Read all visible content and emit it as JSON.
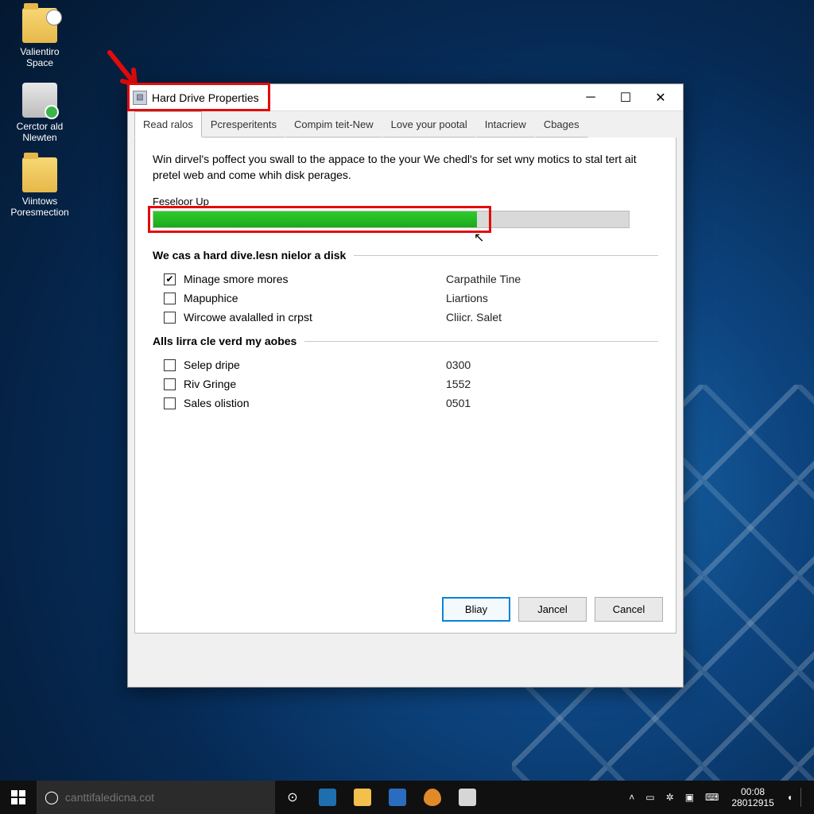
{
  "desktop_icons": [
    {
      "label": "Valientiro Space"
    },
    {
      "label": "Cerctor ald Nlewten"
    },
    {
      "label": "Viintows Poresmection"
    }
  ],
  "window": {
    "title": "Hard Drive Properties",
    "tabs": [
      "Read ralos",
      "Pcresperitents",
      "Compim teit-New",
      "Love your pootal",
      "Intacriew",
      "Cbages"
    ],
    "description": "Win dirvel's poffect you swall to the appace to the your We chedl's for set wny motics to stal tert ait pretel web and come whih disk perages.",
    "progress_label": "Feseloor Up",
    "section1": {
      "title": "We cas a hard dive.lesn nielor a disk",
      "rows": [
        {
          "checked": true,
          "label": "Minage smore mores",
          "value": "Carpathile  Tine"
        },
        {
          "checked": false,
          "label": "Mapuphice",
          "value": "Liartions"
        },
        {
          "checked": false,
          "label": "Wircowe avalalled in crpst",
          "value": "Cliicr. Salet"
        }
      ]
    },
    "section2": {
      "title": "Alls lirra cle verd my aobes",
      "rows": [
        {
          "checked": false,
          "label": "Selep dripe",
          "value": "0300"
        },
        {
          "checked": false,
          "label": "Riv Gringe",
          "value": "1552"
        },
        {
          "checked": false,
          "label": "Sales olistion",
          "value": "0501"
        }
      ]
    },
    "buttons": {
      "ok": "Bliay",
      "apply": "Jancel",
      "cancel": "Cancel"
    }
  },
  "taskbar": {
    "search_placeholder": "canttifaledicna.cot",
    "clock_time": "00:08",
    "clock_date": "28012915"
  },
  "annotation": {
    "highlight_color": "#e30b0b"
  }
}
